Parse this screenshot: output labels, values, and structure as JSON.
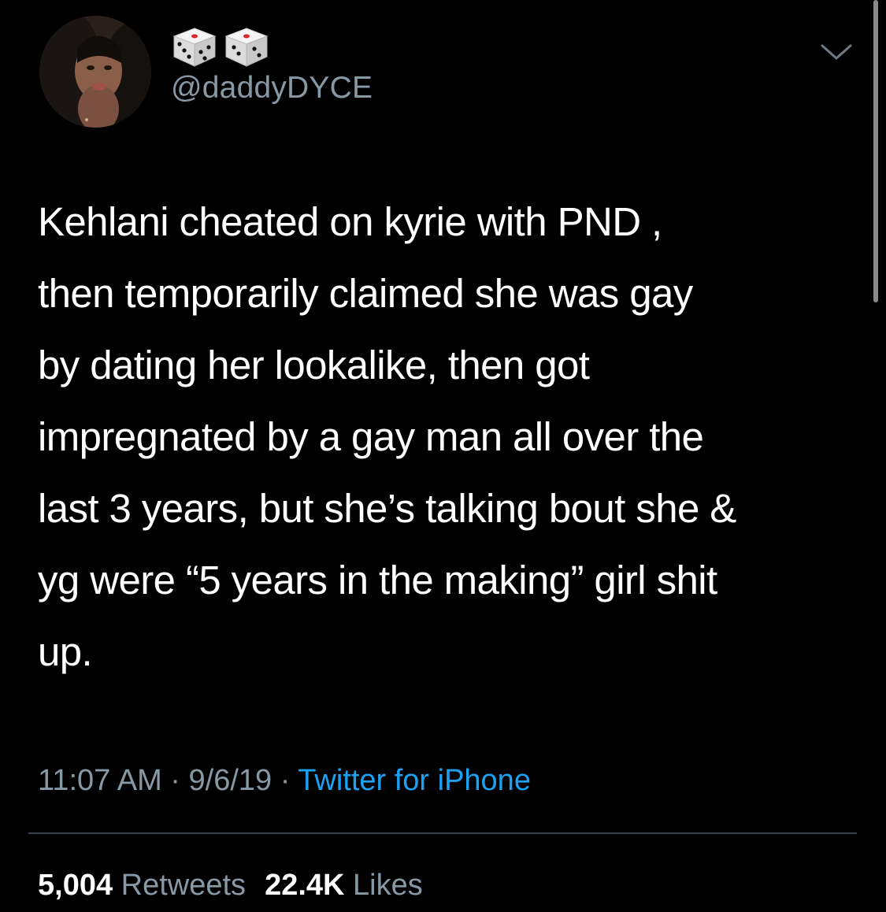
{
  "profile": {
    "handle": "@daddyDYCE",
    "display_name_icons": [
      "die-icon",
      "die-icon"
    ]
  },
  "tweet": {
    "lines": [
      "Kehlani cheated on kyrie with PND ,",
      "then temporarily claimed she was gay",
      "by dating her lookalike, then got",
      "impregnated by a gay man all over the",
      "last 3 years, but she’s talking bout she &",
      "yg were “5 years in the making” girl shit",
      "up."
    ],
    "time": "11:07 AM",
    "date": "9/6/19",
    "separator": " · ",
    "source": "Twitter for iPhone"
  },
  "stats": {
    "retweets_count": "5,004",
    "retweets_label": "Retweets",
    "likes_count": "22.4K",
    "likes_label": "Likes"
  },
  "colors": {
    "background": "#000000",
    "text": "#ffffff",
    "secondary": "#8899a6",
    "link": "#1da1f2",
    "divider": "#38444d"
  }
}
